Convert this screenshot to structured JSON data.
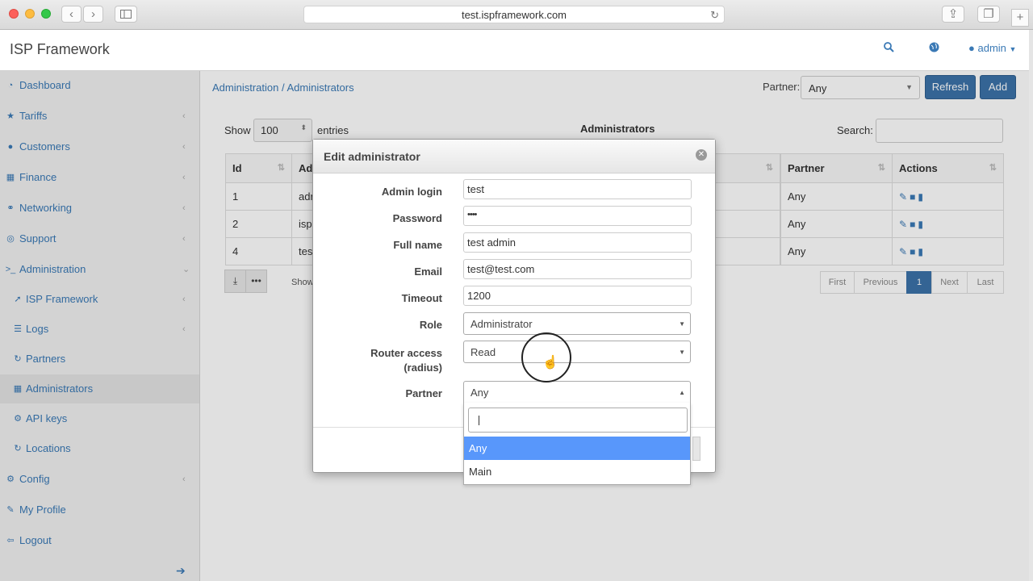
{
  "browser": {
    "url": "test.ispframework.com",
    "back_icon": "chevron-left-icon",
    "forward_icon": "chevron-right-icon",
    "sidebar_toggle_icon": "sidebar-icon",
    "reload_icon": "reload-icon",
    "share_icon": "share-icon",
    "tabs_icon": "tabs-icon",
    "new_tab_icon": "plus-icon"
  },
  "header": {
    "brand": "ISP Framework",
    "search_icon": "search-icon",
    "globe_icon": "globe-icon",
    "user_label": "admin"
  },
  "sidebar": {
    "items": [
      {
        "label": "Dashboard",
        "icon": "dashboard-icon"
      },
      {
        "label": "Tariffs",
        "icon": "star-icon"
      },
      {
        "label": "Customers",
        "icon": "user-icon"
      },
      {
        "label": "Finance",
        "icon": "building-icon"
      },
      {
        "label": "Networking",
        "icon": "sitemap-icon"
      },
      {
        "label": "Support",
        "icon": "lifebuoy-icon"
      },
      {
        "label": "Administration",
        "icon": "terminal-icon"
      },
      {
        "label": "ISP Framework",
        "icon": "rocket-icon"
      },
      {
        "label": "Logs",
        "icon": "list-icon"
      },
      {
        "label": "Partners",
        "icon": "refresh-icon"
      },
      {
        "label": "Administrators",
        "icon": "grid-icon"
      },
      {
        "label": "API keys",
        "icon": "gear-icon"
      },
      {
        "label": "Locations",
        "icon": "refresh-icon"
      },
      {
        "label": "Config",
        "icon": "gears-icon"
      },
      {
        "label": "My Profile",
        "icon": "pencil-icon"
      },
      {
        "label": "Logout",
        "icon": "logout-icon"
      }
    ]
  },
  "main": {
    "breadcrumb": "Administration / Administrators",
    "partner_label": "Partner:",
    "partner_value": "Any",
    "refresh_label": "Refresh",
    "add_label": "Add",
    "show_label": "Show",
    "show_value": "100",
    "entries_label": "entries",
    "table_title": "Administrators",
    "search_label": "Search:",
    "columns": [
      "Id",
      "Ad",
      "",
      "Partner",
      "Actions"
    ],
    "rows": [
      {
        "id": "1",
        "login": "adr",
        "partner": "Any"
      },
      {
        "id": "2",
        "login": "isp",
        "partner": "Any"
      },
      {
        "id": "4",
        "login": "tes",
        "partner": "Any"
      }
    ],
    "show_info": "Show",
    "pager": {
      "first": "First",
      "previous": "Previous",
      "page": "1",
      "next": "Next",
      "last": "Last"
    }
  },
  "modal": {
    "title": "Edit administrator",
    "fields": {
      "admin_login_label": "Admin login",
      "admin_login_value": "test",
      "password_label": "Password",
      "password_value": "••••",
      "full_name_label": "Full name",
      "full_name_value": "test admin",
      "email_label": "Email",
      "email_value": "test@test.com",
      "timeout_label": "Timeout",
      "timeout_value": "1200",
      "role_label": "Role",
      "role_value": "Administrator",
      "router_label_1": "Router access",
      "router_label_2": "(radius)",
      "router_value": "Read",
      "partner_label": "Partner",
      "partner_value": "Any"
    },
    "dropdown_options": [
      "Any",
      "Main"
    ]
  },
  "colors": {
    "accent": "#3a79b5",
    "primary_button": "#3c72a9",
    "selected_option": "#5897fb"
  }
}
